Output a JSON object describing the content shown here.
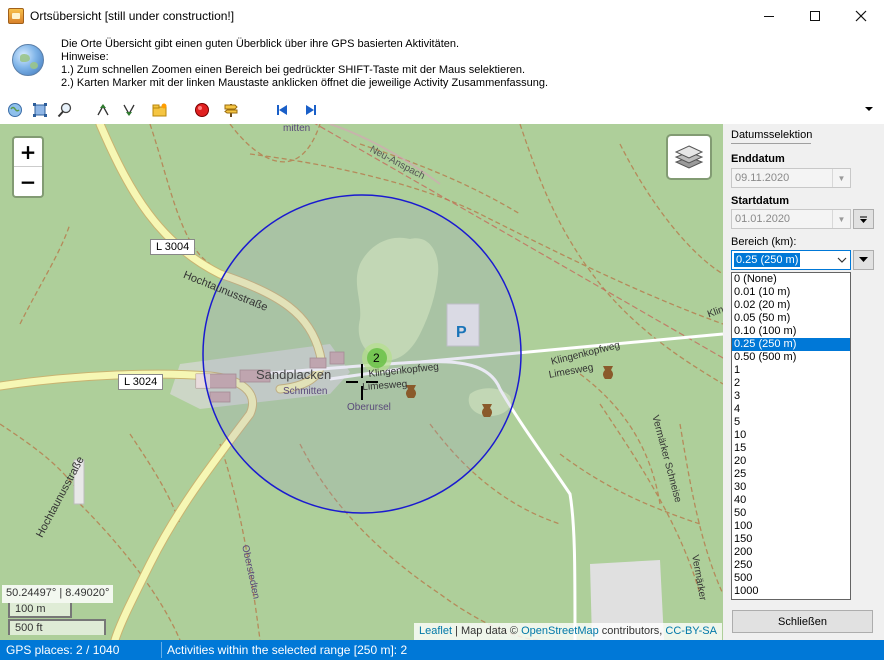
{
  "window": {
    "title": "Ortsübersicht [still under construction!]"
  },
  "info": {
    "line1": "Die Orte Übersicht gibt einen guten Überblick über ihre GPS basierten Aktivitäten.",
    "line2": "Hinweise:",
    "line3": "1.) Zum schnellen Zoomen einen Bereich bei gedrückter SHIFT-Taste mit der Maus selektieren.",
    "line4": "2.) Karten Marker mit der linken Maustaste anklicken öffnet die jeweilige Activity Zusammenfassung."
  },
  "map": {
    "zoom_in": "+",
    "zoom_out": "−",
    "coordinates": "50.24497° | 8.49020°",
    "scale_metric": "100 m",
    "scale_imperial": "500 ft",
    "cluster_count": "2",
    "parking_label": "P",
    "attribution": {
      "leaflet": "Leaflet",
      "sep": " | Map data © ",
      "osm": "OpenStreetMap",
      "contributors": " contributors, ",
      "license": "CC-BY-SA"
    },
    "labels": {
      "l3004": "L 3004",
      "l3024": "L 3024",
      "hochtaunus1": "Hochtaunusstraße",
      "hochtaunus2": "Hochtaunusstraße",
      "sandplacken": "Sandplacken",
      "schmitten": "Schmitten",
      "oberursel": "Oberursel",
      "klingenkopfweg1": "Klingenkopfweg",
      "klingenkopfweg2": "Klingenkopfweg",
      "limesweg1": "Limesweg",
      "limesweg2": "Limesweg",
      "neu_anspach": "Neu-Anspach",
      "schmitten_top": "mitten",
      "vermaerker": "Vermärker Schneise",
      "vermaerker2": "Vermärker",
      "oberstedten": "Oberstedten",
      "kline": "Kline"
    },
    "colors": {
      "forest": "#aecf9a",
      "meadow": "#cde8b0",
      "road_yellow": "#f6f7b4",
      "radius_circle": "#1a1ad0",
      "cluster": "#6ec24b"
    }
  },
  "panel": {
    "group_title": "Datumsselektion",
    "end_label": "Enddatum",
    "end_value": "09.11.2020",
    "start_label": "Startdatum",
    "start_value": "01.01.2020",
    "range_label": "Bereich (km):",
    "range_value": "0.25 (250 m)",
    "range_options": [
      "0 (None)",
      "0.01 (10 m)",
      "0.02 (20 m)",
      "0.05 (50 m)",
      "0.10 (100 m)",
      "0.25 (250 m)",
      "0.50 (500 m)",
      "1",
      "2",
      "3",
      "4",
      "5",
      "10",
      "15",
      "20",
      "25",
      "30",
      "40",
      "50",
      "100",
      "150",
      "200",
      "250",
      "500",
      "1000"
    ],
    "selected_index": 5,
    "close_button": "Schließen"
  },
  "status": {
    "places": "GPS places: 2 / 1040",
    "activities": "Activities within the selected range [250 m]: 2"
  }
}
